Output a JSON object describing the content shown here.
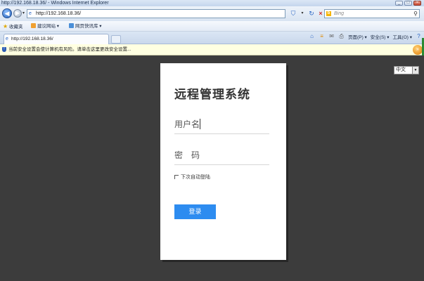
{
  "window": {
    "title": "http://192.168.18.36/ - Windows Internet Explorer",
    "controls": {
      "minimize": "_",
      "maximize": "□",
      "close": "×"
    }
  },
  "address_bar": {
    "url": "http://192.168.18.36/",
    "search_placeholder": "Bing"
  },
  "favorites_bar": {
    "favorites_label": "收藏夹",
    "items": [
      {
        "label": "建议网站 ▾"
      },
      {
        "label": "网页快讯库 ▾"
      }
    ]
  },
  "tabs": [
    {
      "label": "http://192.168.18.36/"
    }
  ],
  "command_bar": {
    "page": "页面(P) ▾",
    "safety": "安全(S) ▾",
    "tools": "工具(O) ▾"
  },
  "infobar": {
    "message": "当前安全设置会使计算机有风险。请单击这里更改安全设置..."
  },
  "language_select": {
    "selected": "中文"
  },
  "login": {
    "title": "远程管理系统",
    "username_placeholder": "用户名",
    "password_placeholder": "密　码",
    "remember_label": "下次自动登陆",
    "submit_label": "登录"
  },
  "colors": {
    "page_background": "#3c3c3c",
    "card_background": "#ffffff",
    "primary_button": "#2d8cf0",
    "infobar_background": "#ffffe1"
  },
  "icons": {
    "back": "back-arrow-icon",
    "forward": "forward-arrow-icon",
    "page": "ie-page-icon",
    "shield": "shield-icon",
    "search": "search-icon",
    "favorites": "star-icon"
  }
}
